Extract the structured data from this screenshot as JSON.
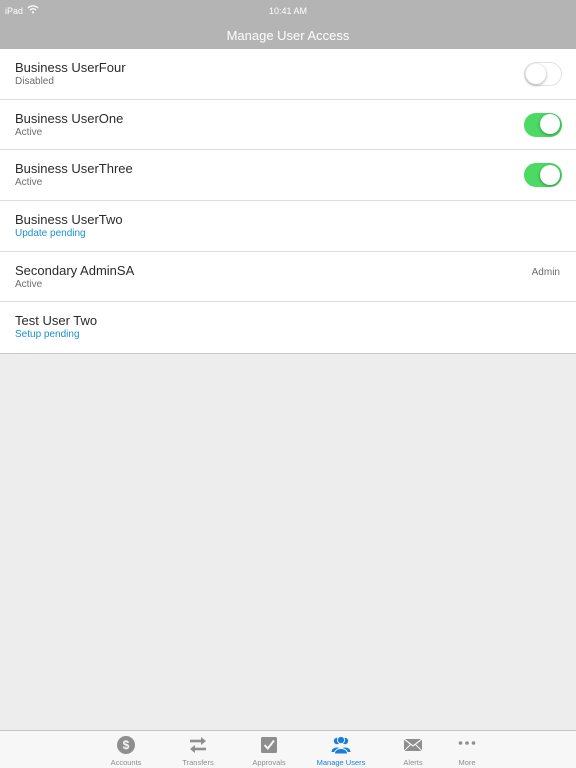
{
  "status_bar": {
    "device": "iPad",
    "time": "10:41 AM"
  },
  "nav": {
    "title": "Manage User Access"
  },
  "users": [
    {
      "name": "Business UserFour",
      "status": "Disabled",
      "toggle": "off"
    },
    {
      "name": "Business UserOne",
      "status": "Active",
      "toggle": "on"
    },
    {
      "name": "Business UserThree",
      "status": "Active",
      "toggle": "on"
    },
    {
      "name": "Business UserTwo",
      "status": "Update pending",
      "status_style": "pending"
    },
    {
      "name": "Secondary AdminSA",
      "status": "Active",
      "role": "Admin"
    },
    {
      "name": "Test User Two",
      "status": "Setup pending",
      "status_style": "pending"
    }
  ],
  "tabs": [
    {
      "label": "Accounts",
      "icon": "dollar-icon"
    },
    {
      "label": "Transfers",
      "icon": "transfer-arrows-icon"
    },
    {
      "label": "Approvals",
      "icon": "checkbox-icon"
    },
    {
      "label": "Manage Users",
      "icon": "users-icon",
      "active": true
    },
    {
      "label": "Alerts",
      "icon": "envelope-icon"
    },
    {
      "label": "More",
      "icon": "more-dots-icon"
    }
  ],
  "colors": {
    "header_bg": "#b4b4b4",
    "toggle_on": "#4cd964",
    "pending_text": "#1a8fd1",
    "active_tab": "#1a7fd6",
    "inactive_tab": "#8e8e8e"
  }
}
